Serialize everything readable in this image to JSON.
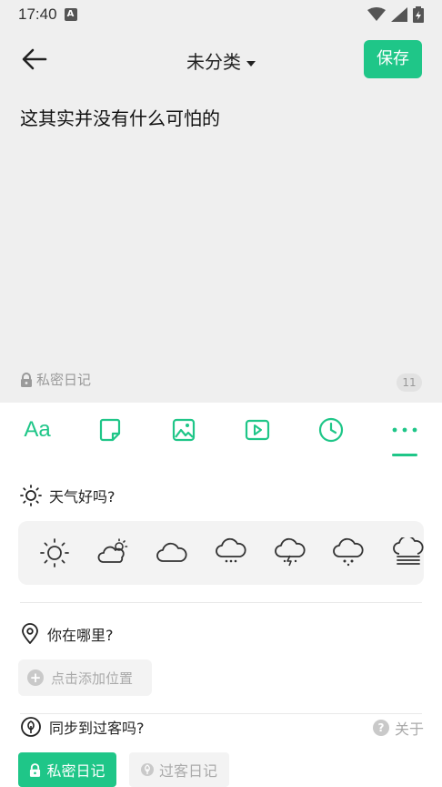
{
  "status": {
    "time": "17:40",
    "badge": "A"
  },
  "appbar": {
    "category": "未分类",
    "save_label": "保存"
  },
  "editor": {
    "content": "这其实并没有什么可怕的"
  },
  "meta": {
    "private_label": "私密日记",
    "char_count": "11"
  },
  "toolbar": {
    "font_label": "Aa"
  },
  "weather": {
    "title": "天气好吗?",
    "icons": [
      "sunny-icon",
      "partly-cloudy-icon",
      "cloudy-icon",
      "rain-icon",
      "thunderstorm-icon",
      "snow-icon",
      "fog-icon"
    ]
  },
  "location": {
    "title": "你在哪里?",
    "add_label": "点击添加位置"
  },
  "sync": {
    "title": "同步到过客吗?",
    "about_label": "关于",
    "private_btn": "私密日记",
    "guest_btn": "过客日记"
  },
  "colors": {
    "accent": "#1fc688",
    "background": "#efefef"
  }
}
